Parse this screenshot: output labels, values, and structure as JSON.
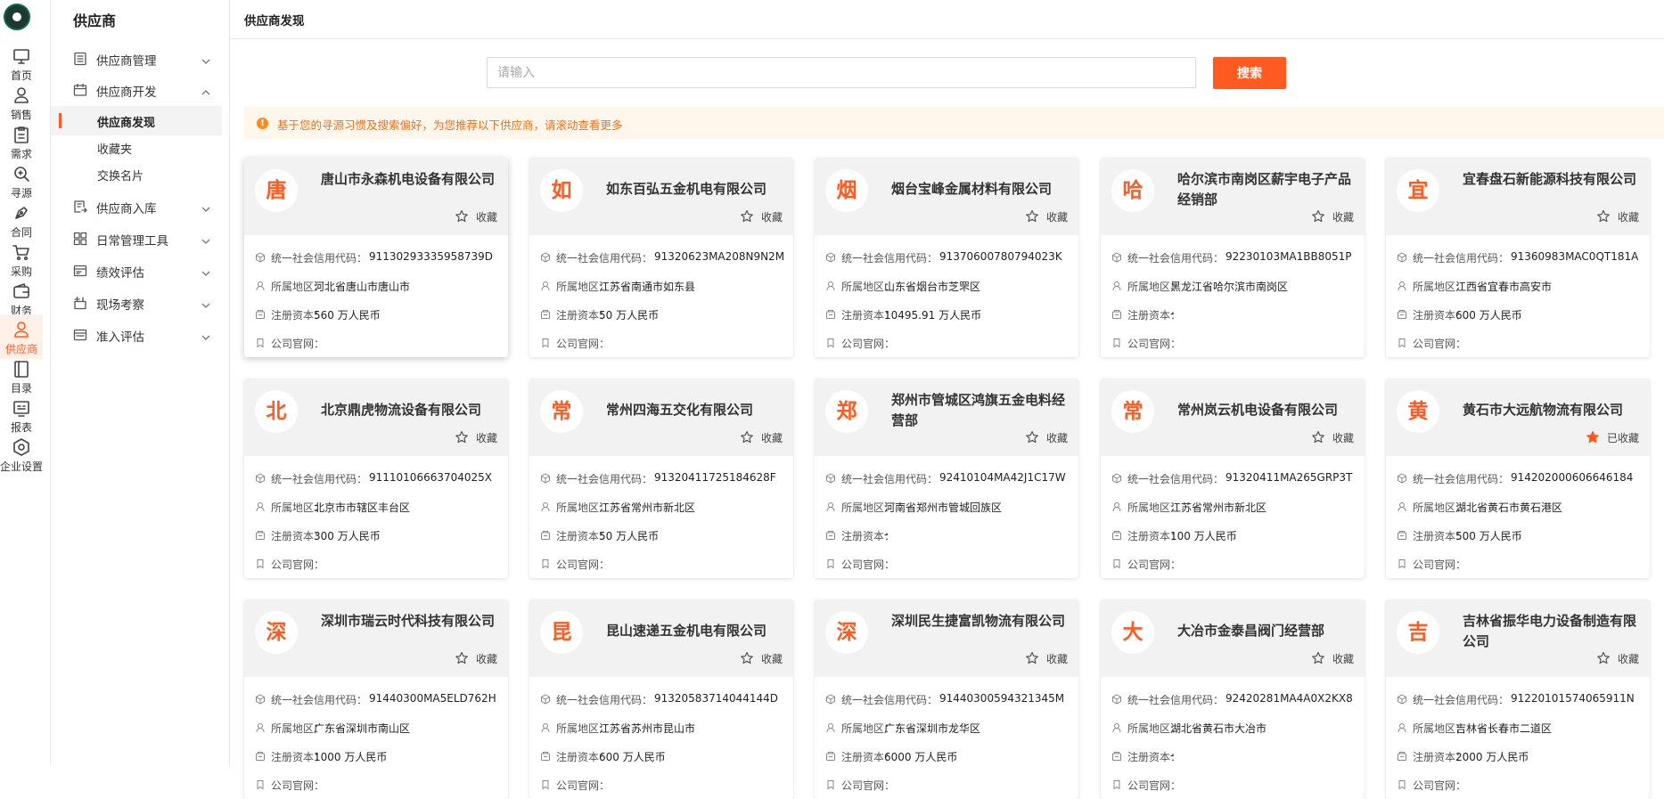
{
  "rail": [
    {
      "label": "首页",
      "icon": "monitor-icon"
    },
    {
      "label": "销售",
      "icon": "user-icon"
    },
    {
      "label": "需求",
      "icon": "clipboard-icon"
    },
    {
      "label": "寻源",
      "icon": "search-icon"
    },
    {
      "label": "合同",
      "icon": "pen-icon"
    },
    {
      "label": "采购",
      "icon": "cart-icon"
    },
    {
      "label": "财务",
      "icon": "wallet-icon"
    },
    {
      "label": "供应商",
      "icon": "supplier-icon",
      "active": true
    },
    {
      "label": "目录",
      "icon": "catalog-icon"
    },
    {
      "label": "报表",
      "icon": "report-icon"
    },
    {
      "label": "企业设置",
      "icon": "settings-icon"
    }
  ],
  "menu": {
    "title": "供应商",
    "groups": [
      {
        "label": "供应商管理",
        "icon": "list-icon",
        "expanded": false
      },
      {
        "label": "供应商开发",
        "icon": "calendar-icon",
        "expanded": true,
        "children": [
          {
            "label": "供应商发现",
            "active": true
          },
          {
            "label": "收藏夹"
          },
          {
            "label": "交换名片"
          }
        ]
      },
      {
        "label": "供应商入库",
        "icon": "inbound-icon",
        "expanded": false
      },
      {
        "label": "日常管理工具",
        "icon": "grid-icon",
        "expanded": false
      },
      {
        "label": "绩效评估",
        "icon": "evaluation-icon",
        "expanded": false
      },
      {
        "label": "现场考察",
        "icon": "inspection-icon",
        "expanded": false
      },
      {
        "label": "准入评估",
        "icon": "admission-icon",
        "expanded": false
      }
    ]
  },
  "page": {
    "title": "供应商发现",
    "search_placeholder": "请输入",
    "search_value": "",
    "search_button": "搜索",
    "notice": "基于您的寻源习惯及搜索偏好，为您推荐以下供应商，请滚动查看更多"
  },
  "labels": {
    "credit_code": "统一社会信用代码：",
    "region": "所属地区：",
    "capital": "注册资本：",
    "website": "公司官网："
  },
  "colors": {
    "accent": "#ff5a1f",
    "notice_bg": "#fff6ec",
    "notice_text": "#e8741c"
  },
  "cards": [
    {
      "avatar": "唐",
      "name": "唐山市永森机电设备有限公司",
      "fav": "收藏",
      "favorited": false,
      "code": "91130293335958739D",
      "region": "河北省唐山市唐山市",
      "capital": "560 万人民币",
      "website": ""
    },
    {
      "avatar": "如",
      "name": "如东百弘五金机电有限公司",
      "fav": "收藏",
      "favorited": false,
      "code": "91320623MA208N9N2M",
      "region": "江苏省南通市如东县",
      "capital": "50 万人民币",
      "website": ""
    },
    {
      "avatar": "烟",
      "name": "烟台宝峰金属材料有限公司",
      "fav": "收藏",
      "favorited": false,
      "code": "91370600780794023K",
      "region": "山东省烟台市芝罘区",
      "capital": "10495.91 万人民币",
      "website": ""
    },
    {
      "avatar": "哈",
      "name": "哈尔滨市南岗区薪宇电子产品经销部",
      "fav": "收藏",
      "favorited": false,
      "code": "92230103MA1BB8051P",
      "region": "黑龙江省哈尔滨市南岗区",
      "capital": "-",
      "website": ""
    },
    {
      "avatar": "宜",
      "name": "宜春盘石新能源科技有限公司",
      "fav": "收藏",
      "favorited": false,
      "code": "91360983MAC0QT181A",
      "region": "江西省宜春市高安市",
      "capital": "600 万人民币",
      "website": ""
    },
    {
      "avatar": "北",
      "name": "北京鼎虎物流设备有限公司",
      "fav": "收藏",
      "favorited": false,
      "code": "91110106663704025X",
      "region": "北京市市辖区丰台区",
      "capital": "300 万人民币",
      "website": ""
    },
    {
      "avatar": "常",
      "name": "常州四海五交化有限公司",
      "fav": "收藏",
      "favorited": false,
      "code": "91320411725184628F",
      "region": "江苏省常州市新北区",
      "capital": "50 万人民币",
      "website": ""
    },
    {
      "avatar": "郑",
      "name": "郑州市管城区鸿旗五金电料经营部",
      "fav": "收藏",
      "favorited": false,
      "code": "92410104MA42J1C17W",
      "region": "河南省郑州市管城回族区",
      "capital": "-",
      "website": ""
    },
    {
      "avatar": "常",
      "name": "常州岚云机电设备有限公司",
      "fav": "收藏",
      "favorited": false,
      "code": "91320411MA265GRP3T",
      "region": "江苏省常州市新北区",
      "capital": "100 万人民币",
      "website": ""
    },
    {
      "avatar": "黄",
      "name": "黄石市大远航物流有限公司",
      "fav": "已收藏",
      "favorited": true,
      "code": "914202000606646184",
      "region": "湖北省黄石市黄石港区",
      "capital": "500 万人民币",
      "website": ""
    },
    {
      "avatar": "深",
      "name": "深圳市瑞云时代科技有限公司",
      "fav": "收藏",
      "favorited": false,
      "code": "91440300MA5ELD762H",
      "region": "广东省深圳市南山区",
      "capital": "1000 万人民币",
      "website": ""
    },
    {
      "avatar": "昆",
      "name": "昆山速递五金机电有限公司",
      "fav": "收藏",
      "favorited": false,
      "code": "91320583714044144D",
      "region": "江苏省苏州市昆山市",
      "capital": "600 万人民币",
      "website": ""
    },
    {
      "avatar": "深",
      "name": "深圳民生捷富凯物流有限公司",
      "fav": "收藏",
      "favorited": false,
      "code": "91440300594321345M",
      "region": "广东省深圳市龙华区",
      "capital": "6000 万人民币",
      "website": ""
    },
    {
      "avatar": "大",
      "name": "大冶市金泰昌阀门经营部",
      "fav": "收藏",
      "favorited": false,
      "code": "92420281MA4A0X2KX8",
      "region": "湖北省黄石市大冶市",
      "capital": "-",
      "website": ""
    },
    {
      "avatar": "吉",
      "name": "吉林省振华电力设备制造有限公司",
      "fav": "收藏",
      "favorited": false,
      "code": "91220101574065911N",
      "region": "吉林省长春市二道区",
      "capital": "2000 万人民币",
      "website": ""
    }
  ]
}
